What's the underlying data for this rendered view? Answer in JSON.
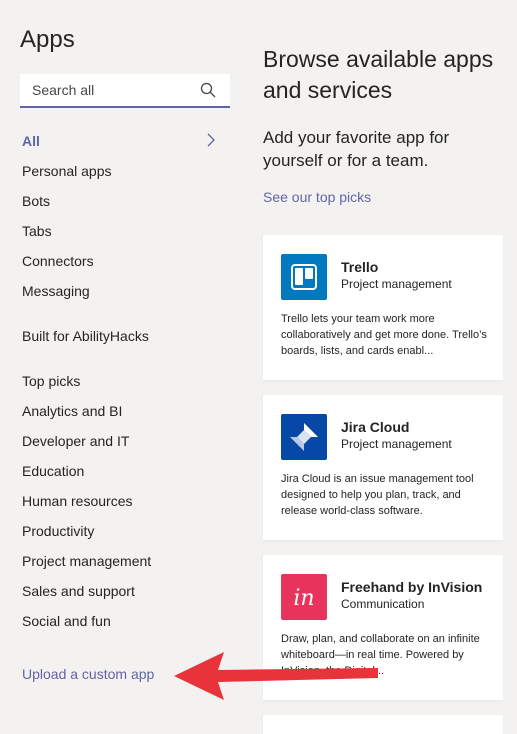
{
  "sidebar": {
    "title": "Apps",
    "search_placeholder": "Search all",
    "items_primary": [
      "All",
      "Personal apps",
      "Bots",
      "Tabs",
      "Connectors",
      "Messaging"
    ],
    "org_item": "Built for AbilityHacks",
    "categories": [
      "Top picks",
      "Analytics and BI",
      "Developer and IT",
      "Education",
      "Human resources",
      "Productivity",
      "Project management",
      "Sales and support",
      "Social and fun"
    ],
    "upload_label": "Upload a custom app"
  },
  "main": {
    "heading": "Browse available apps and services",
    "subheading": "Add your favorite app for yourself or for a team.",
    "top_picks_link": "See our top picks",
    "cards": [
      {
        "name": "Trello",
        "category": "Project management",
        "description": "Trello lets your team work more collaboratively and get more done. Trello’s boards, lists, and cards enabl...",
        "logo_color": "#0079bf",
        "logo_icon": "trello-icon"
      },
      {
        "name": "Jira Cloud",
        "category": "Project management",
        "description": "Jira Cloud is an issue management tool designed to help you plan, track, and release world-class software.",
        "logo_color": "#0747a6",
        "logo_icon": "jira-icon"
      },
      {
        "name": "Freehand by InVision",
        "category": "Communication",
        "description": "Draw, plan, and collaborate on an infinite whiteboard—in real time. Powered by InVision, the Digital...",
        "logo_color": "#e8345d",
        "logo_icon": "invision-icon",
        "logo_text": "in"
      }
    ]
  },
  "colors": {
    "accent": "#6264a7",
    "background": "#f3f2f1",
    "arrow": "#e8333a"
  }
}
